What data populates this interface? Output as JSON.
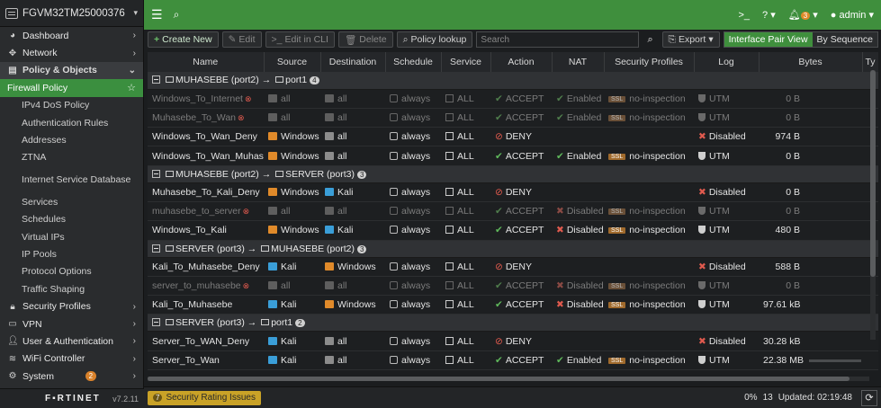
{
  "device": {
    "name": "FGVM32TM25000376"
  },
  "sidebar": {
    "items": [
      {
        "label": "Dashboard",
        "icon": "dashboard-icon",
        "kind": "top",
        "chev": "›"
      },
      {
        "label": "Network",
        "icon": "network-icon",
        "kind": "top",
        "chev": "›"
      },
      {
        "label": "Policy & Objects",
        "icon": "policy-icon",
        "kind": "active-parent",
        "chev": "⌄"
      },
      {
        "label": "Firewall Policy",
        "kind": "selected"
      },
      {
        "label": "IPv4 DoS Policy",
        "kind": "sub"
      },
      {
        "label": "Authentication Rules",
        "kind": "sub"
      },
      {
        "label": "Addresses",
        "kind": "sub"
      },
      {
        "label": "ZTNA",
        "kind": "sub"
      },
      {
        "label": "Internet Service Database",
        "kind": "sub twoline"
      },
      {
        "label": "Services",
        "kind": "sub"
      },
      {
        "label": "Schedules",
        "kind": "sub"
      },
      {
        "label": "Virtual IPs",
        "kind": "sub"
      },
      {
        "label": "IP Pools",
        "kind": "sub"
      },
      {
        "label": "Protocol Options",
        "kind": "sub"
      },
      {
        "label": "Traffic Shaping",
        "kind": "sub"
      },
      {
        "label": "Security Profiles",
        "icon": "lock-icon",
        "kind": "top",
        "chev": "›"
      },
      {
        "label": "VPN",
        "icon": "vpn-icon",
        "kind": "top",
        "chev": "›"
      },
      {
        "label": "User & Authentication",
        "icon": "user-icon",
        "kind": "top",
        "chev": "›"
      },
      {
        "label": "WiFi Controller",
        "icon": "wifi-icon",
        "kind": "top",
        "chev": "›"
      },
      {
        "label": "System",
        "icon": "gear-icon",
        "kind": "top",
        "chev": "›",
        "badge": "2"
      }
    ],
    "footer": {
      "brand": "F▪RTINET",
      "version": "v7.2.11"
    }
  },
  "topbar": {
    "cli": ">_",
    "help": "?",
    "notif_count": "3",
    "user": "admin"
  },
  "toolbar": {
    "create": "Create New",
    "edit": "Edit",
    "edit_cli": "Edit in CLI",
    "delete": "Delete",
    "policy_lookup": "Policy lookup",
    "search_placeholder": "Search",
    "export": "Export",
    "view_interface": "Interface Pair View",
    "view_sequence": "By Sequence"
  },
  "columns": [
    "Name",
    "Source",
    "Destination",
    "Schedule",
    "Service",
    "Action",
    "NAT",
    "Security Profiles",
    "Log",
    "Bytes",
    "Ty"
  ],
  "groups": [
    {
      "from": "MUHASEBE (port2)",
      "to": "port1",
      "count": "4",
      "rows": [
        {
          "name": "Windows_To_Internet",
          "disabled": true,
          "src": "all",
          "src_color": "gray",
          "dst": "all",
          "dst_color": "gray",
          "schedule": "always",
          "service": "ALL",
          "action": "ACCEPT",
          "nat": "Enabled",
          "profile": "no-inspection",
          "log": "UTM",
          "bytes": "0 B"
        },
        {
          "name": "Muhasebe_To_Wan",
          "disabled": true,
          "src": "all",
          "src_color": "gray",
          "dst": "all",
          "dst_color": "gray",
          "schedule": "always",
          "service": "ALL",
          "action": "ACCEPT",
          "nat": "Enabled",
          "profile": "no-inspection",
          "log": "UTM",
          "bytes": "0 B"
        },
        {
          "name": "Windows_To_Wan_Deny",
          "disabled": false,
          "src": "Windows",
          "src_color": "orange",
          "dst": "all",
          "dst_color": "gray",
          "schedule": "always",
          "service": "ALL",
          "action": "DENY",
          "nat": "",
          "profile": "",
          "log": "Disabled",
          "bytes": "974 B"
        },
        {
          "name": "Windows_To_Wan_Muhasebe",
          "disabled": false,
          "src": "Windows",
          "src_color": "orange",
          "dst": "all",
          "dst_color": "gray",
          "schedule": "always",
          "service": "ALL",
          "action": "ACCEPT",
          "nat": "Enabled",
          "profile": "no-inspection",
          "log": "UTM",
          "bytes": "0 B"
        }
      ]
    },
    {
      "from": "MUHASEBE (port2)",
      "to": "SERVER (port3)",
      "count": "3",
      "rows": [
        {
          "name": "Muhasebe_To_Kali_Deny",
          "disabled": false,
          "src": "Windows",
          "src_color": "orange",
          "dst": "Kali",
          "dst_color": "blue",
          "schedule": "always",
          "service": "ALL",
          "action": "DENY",
          "nat": "",
          "profile": "",
          "log": "Disabled",
          "bytes": "0 B"
        },
        {
          "name": "muhasebe_to_server",
          "disabled": true,
          "src": "all",
          "src_color": "gray",
          "dst": "all",
          "dst_color": "gray",
          "schedule": "always",
          "service": "ALL",
          "action": "ACCEPT",
          "nat": "Disabled",
          "profile": "no-inspection",
          "log": "UTM",
          "bytes": "0 B"
        },
        {
          "name": "Windows_To_Kali",
          "disabled": false,
          "src": "Windows",
          "src_color": "orange",
          "dst": "Kali",
          "dst_color": "blue",
          "schedule": "always",
          "service": "ALL",
          "action": "ACCEPT",
          "nat": "Disabled",
          "profile": "no-inspection",
          "log": "UTM",
          "bytes": "480 B"
        }
      ]
    },
    {
      "from": "SERVER (port3)",
      "to": "MUHASEBE (port2)",
      "count": "3",
      "rows": [
        {
          "name": "Kali_To_Muhasebe_Deny",
          "disabled": false,
          "src": "Kali",
          "src_color": "blue",
          "dst": "Windows",
          "dst_color": "orange",
          "schedule": "always",
          "service": "ALL",
          "action": "DENY",
          "nat": "",
          "profile": "",
          "log": "Disabled",
          "bytes": "588 B"
        },
        {
          "name": "server_to_muhasebe",
          "disabled": true,
          "src": "all",
          "src_color": "gray",
          "dst": "all",
          "dst_color": "gray",
          "schedule": "always",
          "service": "ALL",
          "action": "ACCEPT",
          "nat": "Disabled",
          "profile": "no-inspection",
          "log": "UTM",
          "bytes": "0 B"
        },
        {
          "name": "Kali_To_Muhasebe",
          "disabled": false,
          "src": "Kali",
          "src_color": "blue",
          "dst": "Windows",
          "dst_color": "orange",
          "schedule": "always",
          "service": "ALL",
          "action": "ACCEPT",
          "nat": "Disabled",
          "profile": "no-inspection",
          "log": "UTM",
          "bytes": "97.61 kB"
        }
      ]
    },
    {
      "from": "SERVER (port3)",
      "to": "port1",
      "count": "2",
      "rows": [
        {
          "name": "Server_To_WAN_Deny",
          "disabled": false,
          "src": "Kali",
          "src_color": "blue",
          "dst": "all",
          "dst_color": "gray",
          "schedule": "always",
          "service": "ALL",
          "action": "DENY",
          "nat": "",
          "profile": "",
          "log": "Disabled",
          "bytes": "30.28 kB"
        },
        {
          "name": "Server_To_Wan",
          "disabled": false,
          "src": "Kali",
          "src_color": "blue",
          "dst": "all",
          "dst_color": "gray",
          "schedule": "always",
          "service": "ALL",
          "action": "ACCEPT",
          "nat": "Enabled",
          "profile": "no-inspection",
          "log": "UTM",
          "bytes": "22.38 MB",
          "bytes_bar": true
        }
      ]
    }
  ],
  "footer": {
    "rating_count": "7",
    "rating_label": "Security Rating Issues",
    "percent": "0%",
    "count": "13",
    "updated": "Updated: 02:19:48"
  },
  "colors": {
    "accent": "#3f8f3d",
    "warning": "#c9a227",
    "deny": "#e05a4e",
    "accept": "#5fb85b"
  }
}
